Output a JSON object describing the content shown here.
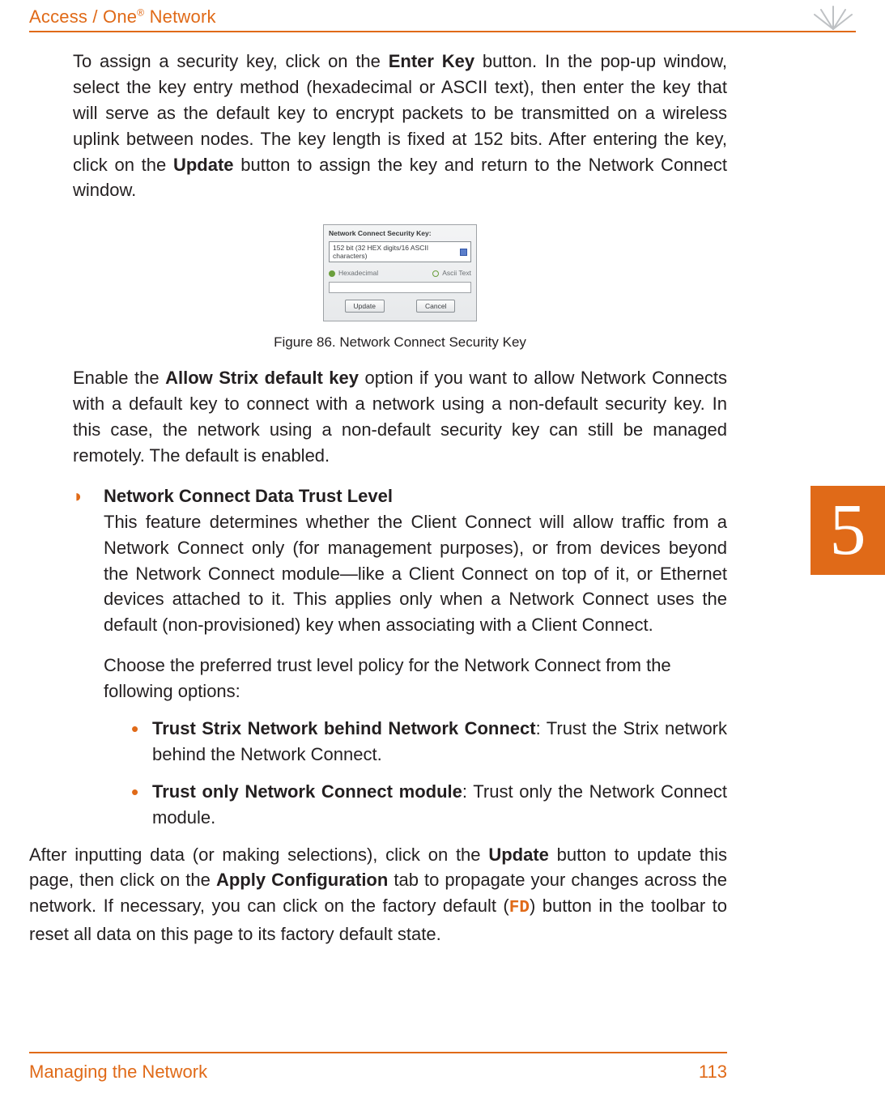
{
  "header": {
    "title_pre": "Access / One",
    "title_sup": "®",
    "title_post": " Network"
  },
  "tab": {
    "number": "5"
  },
  "footer": {
    "left": "Managing the Network",
    "page": "113"
  },
  "para1": {
    "pre": "To assign a security key, click on the ",
    "b1": "Enter Key",
    "mid1": " button. In the pop-up window, select the key entry method (hexadecimal or ASCII text), then enter the key that will serve as the default key to encrypt packets to be transmitted on a wireless uplink between nodes. The key length is fixed at 152 bits. After entering the key, click on the ",
    "b2": "Update",
    "post": " button to assign the key and return to the Network Connect window."
  },
  "figure": {
    "box": {
      "title": "Network Connect Security Key:",
      "select": "152 bit (32 HEX digits/16 ASCII characters)",
      "opt_hex": "Hexadecimal",
      "opt_ascii": "Ascii Text",
      "btn_update": "Update",
      "btn_cancel": "Cancel"
    },
    "caption": "Figure 86. Network Connect Security Key"
  },
  "para2": {
    "pre": "Enable the ",
    "b1": "Allow Strix default key",
    "post": " option if you want to allow Network Connects with a default key to connect with a network using a non-default security key. In this case, the network using a non-default security key can still be managed remotely. The default is enabled."
  },
  "bulletD": {
    "header": "Network Connect Data Trust Level",
    "para": "This feature determines whether the Client Connect will allow traffic from a Network Connect only (for management purposes), or from devices beyond the Network Connect module—like a Client Connect on top of it, or Ethernet devices attached to it. This applies only when a Network Connect uses the default (non-provisioned) key when associating with a Client Connect.",
    "para2": "Choose the preferred trust level policy for the Network Connect from the following options:"
  },
  "sub": [
    {
      "b": "Trust Strix Network behind Network Connect",
      "rest": ": Trust the Strix network behind the Network Connect."
    },
    {
      "b": "Trust only Network Connect module",
      "rest": ": Trust only the Network Connect module."
    }
  ],
  "after": {
    "pre": "After inputting data (or making selections), click on the ",
    "b1": "Update",
    "mid1": " button to update this page, then click on the ",
    "b2": "Apply Configuration",
    "mid2": " tab to propagate your changes across the network. If necessary, you can click on the factory default (",
    "fd": "FD",
    "post": ") button in the toolbar to reset all data on this page to its factory default state."
  }
}
